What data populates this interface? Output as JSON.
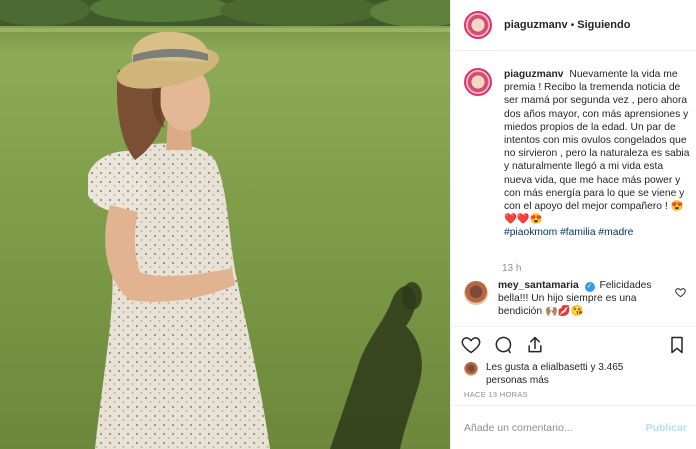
{
  "post": {
    "author": "piaguzmanv",
    "separator": "•",
    "follow_status": "Siguiendo"
  },
  "caption": {
    "username": "piaguzmanv",
    "body": "Nuevamente la vida me premia ! Recibo la tremenda noticia de ser mamá por segunda vez , pero ahora dos años mayor, con más aprensiones y miedos propios de la edad. Un par de intentos con mis ovulos congelados que no sirvieron , pero la naturaleza es sabia y naturalmente llegó a mi vida esta nueva vida, que me hace más power y con más energía para lo que se viene y con el apoyo del mejor compañero ! 😍❤️❤️😍",
    "hashtags": "#piaokmom #familia #madre",
    "time": "13 h"
  },
  "comment": {
    "username": "mey_santamaria",
    "verified_mark": "✓",
    "text": "Felicidades bella!!! Un hijo siempre es una bendición 🙌🏽💋😘"
  },
  "likes": {
    "text": "Les gusta a elialbasetti y 3.465 personas más"
  },
  "timestamp": "HACE 13 HORAS",
  "add_comment": {
    "placeholder": "Añade un comentario...",
    "publish": "Publicar"
  },
  "icons": {
    "like": "heart-icon",
    "comment": "comment-icon",
    "share": "share-icon",
    "save": "bookmark-icon"
  },
  "colors": {
    "link": "#00376b",
    "verified": "#3897f0",
    "publish_disabled": "#b2dffc",
    "muted": "#8e8e8e"
  }
}
